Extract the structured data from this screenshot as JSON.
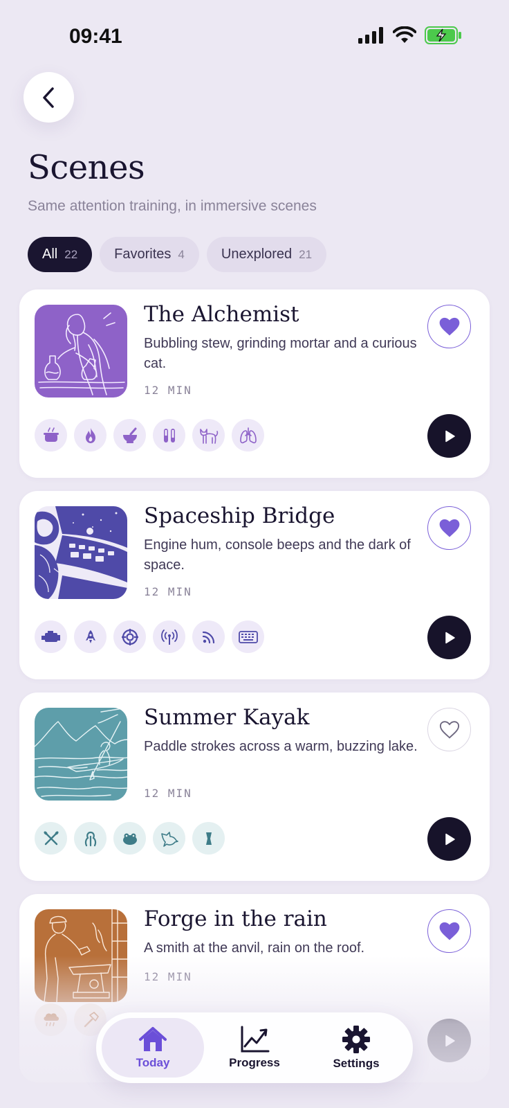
{
  "status_bar": {
    "time": "09:41"
  },
  "header": {
    "title": "Scenes",
    "subtitle": "Same attention training, in immersive scenes"
  },
  "filters": [
    {
      "label": "All",
      "count": "22",
      "active": true
    },
    {
      "label": "Favorites",
      "count": "4",
      "active": false
    },
    {
      "label": "Unexplored",
      "count": "21",
      "active": false
    }
  ],
  "colors": {
    "background": "#ECE8F3",
    "accent": "#7A5FD8",
    "dark": "#1A1530",
    "violet_scene": "#8E62C8",
    "navy_scene": "#4F4AA8",
    "teal_scene": "#5E9EAA",
    "orange_scene": "#B8703A"
  },
  "scenes": [
    {
      "title": "The Alchemist",
      "description": "Bubbling stew, grinding mortar and a curious cat.",
      "duration": "12 MIN",
      "favorite": true,
      "sounds": [
        "cauldron-icon",
        "flame-icon",
        "mortar-icon",
        "test-tubes-icon",
        "cat-icon",
        "lungs-icon"
      ]
    },
    {
      "title": "Spaceship Bridge",
      "description": "Engine hum, console beeps and the dark of space.",
      "duration": "12 MIN",
      "favorite": true,
      "sounds": [
        "engine-icon",
        "rocket-icon",
        "target-icon",
        "antenna-icon",
        "signal-icon",
        "keyboard-icon"
      ]
    },
    {
      "title": "Summer Kayak",
      "description": "Paddle strokes across a warm, buzzing lake.",
      "duration": "12 MIN",
      "favorite": false,
      "sounds": [
        "paddles-icon",
        "insect-icon",
        "frog-icon",
        "bird-icon",
        "bug-icon"
      ]
    },
    {
      "title": "Forge in the rain",
      "description": "A smith at the anvil, rain on the roof.",
      "duration": "12 MIN",
      "favorite": true,
      "sounds": [
        "rain-cloud-icon",
        "hammer-icon"
      ]
    }
  ],
  "tabbar": [
    {
      "label": "Today",
      "icon": "home-icon",
      "active": true
    },
    {
      "label": "Progress",
      "icon": "chart-icon",
      "active": false
    },
    {
      "label": "Settings",
      "icon": "gear-icon",
      "active": false
    }
  ]
}
